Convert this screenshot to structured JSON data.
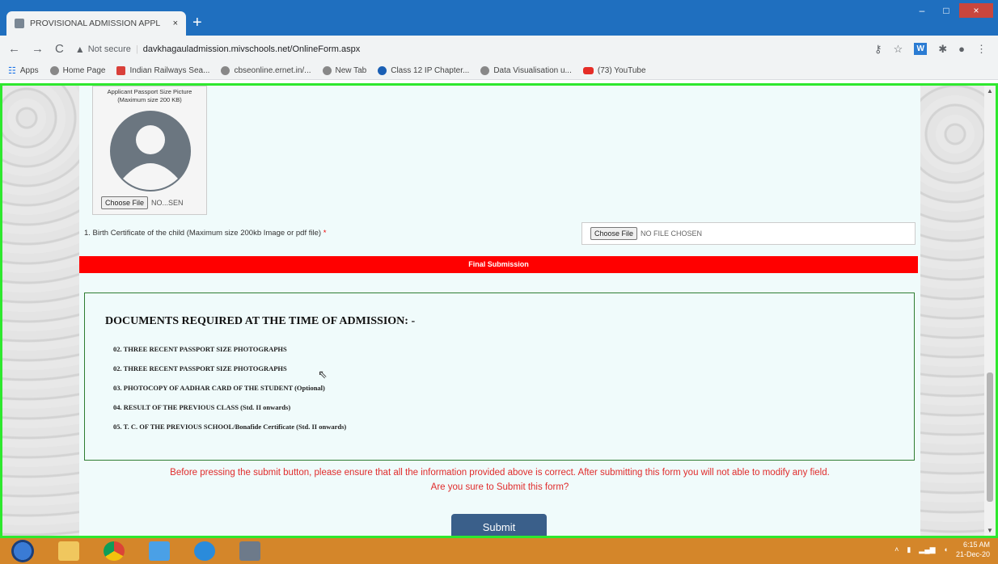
{
  "browser": {
    "tab_title": "PROVISIONAL ADMISSION APPL",
    "tab_close": "×",
    "new_tab": "+",
    "window_buttons": [
      "–",
      "□",
      "×"
    ],
    "nav": {
      "back": "←",
      "forward": "→",
      "reload": "C"
    },
    "security_label": "Not secure",
    "url": "davkhagauladmission.mivschools.net/OnlineForm.aspx",
    "bookmarks": [
      {
        "label": "Apps",
        "icon": "apps-grid-icon"
      },
      {
        "label": "Home Page",
        "icon": "globe-icon"
      },
      {
        "label": "Indian Railways Sea...",
        "icon": "railway-icon"
      },
      {
        "label": "cbseonline.ernet.in/...",
        "icon": "globe-icon"
      },
      {
        "label": "New Tab",
        "icon": "globe-icon"
      },
      {
        "label": "Class 12 IP Chapter...",
        "icon": "blue-circle-icon"
      },
      {
        "label": "Data Visualisation u...",
        "icon": "globe-icon"
      },
      {
        "label": "(73) YouTube",
        "icon": "youtube-icon"
      }
    ]
  },
  "form": {
    "photo_caption": "Applicant Passport Size Picture (Maximum size 200 KB)",
    "photo_choose_label": "Choose File",
    "photo_file_status": "NO...SEN",
    "birth_label": "1. Birth Certificate of the child (Maximum size 200kb Image or pdf file)",
    "required_mark": "*",
    "birth_choose_label": "Choose File",
    "birth_file_status": "NO FILE CHOSEN",
    "final_submission": "Final Submission",
    "documents_heading": "DOCUMENTS REQUIRED AT THE TIME OF ADMISSION: -",
    "documents": [
      "02. THREE RECENT PASSPORT SIZE PHOTOGRAPHS",
      "02. THREE RECENT PASSPORT SIZE PHOTOGRAPHS",
      "03. PHOTOCOPY OF AADHAR CARD OF THE STUDENT (Optional)",
      "04. RESULT OF THE PREVIOUS CLASS (Std. II onwards)",
      "05. T. C. OF THE PREVIOUS SCHOOL/Bonafide Certificate (Std. II onwards)"
    ],
    "warning_line1": "Before pressing the submit button, please ensure that all the information provided above is correct. After submitting this form you will not able to modify any field.",
    "warning_line2": "Are you sure to Submit this form?",
    "submit_label": "Submit"
  },
  "taskbar": {
    "time": "6:15 AM",
    "date": "21-Dec-20"
  },
  "colors": {
    "final_bar": "#ff0000",
    "warning_text": "#e02b2b",
    "submit_bg": "#3a5f8a",
    "doc_border": "#2e7d32",
    "viewport_border": "#2ee82e"
  }
}
